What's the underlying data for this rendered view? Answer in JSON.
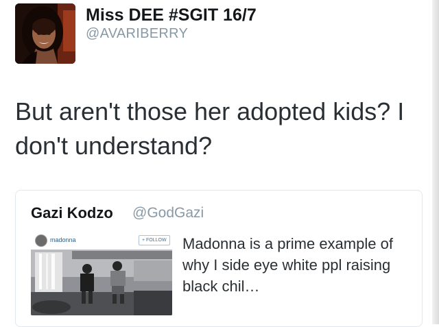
{
  "author": {
    "display_name": "Miss DEE #SGIT 16/7",
    "handle": "@AVARIBERRY"
  },
  "tweet": {
    "text": "But aren't those her adopted kids? I don't understand?"
  },
  "quoted_tweet": {
    "display_name": "Gazi Kodzo",
    "handle": "@GodGazi",
    "text": "Madonna is a prime example of why I side eye white ppl raising black chil…",
    "media": {
      "username": "madonna",
      "follow_label": "+ FOLLOW"
    }
  },
  "colors": {
    "text": "#292f33",
    "secondary_text": "#8899a6",
    "card_border": "#e1e8ed",
    "instagram_blue": "#3f729b"
  },
  "icons": {
    "avatar": "profile-photo",
    "media_avatar": "instagram-profile-avatar"
  }
}
